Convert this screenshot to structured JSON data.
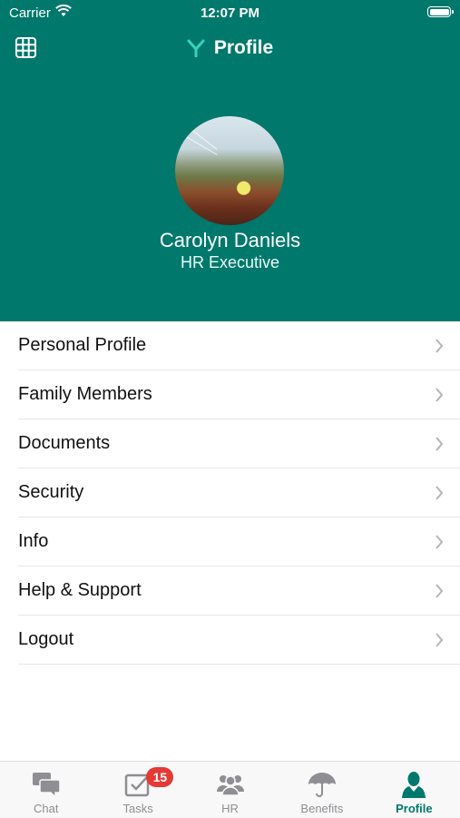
{
  "status_bar": {
    "carrier": "Carrier",
    "time": "12:07 PM"
  },
  "nav": {
    "title": "Profile",
    "logo": "y-logo"
  },
  "profile": {
    "name": "Carolyn Daniels",
    "role": "HR Executive"
  },
  "menu": {
    "items": [
      {
        "label": "Personal Profile"
      },
      {
        "label": "Family Members"
      },
      {
        "label": "Documents"
      },
      {
        "label": "Security"
      },
      {
        "label": "Info"
      },
      {
        "label": "Help & Support"
      },
      {
        "label": "Logout"
      }
    ]
  },
  "tabs": {
    "items": [
      {
        "label": "Chat",
        "icon": "chat-icon"
      },
      {
        "label": "Tasks",
        "icon": "tasks-icon",
        "badge": "15"
      },
      {
        "label": "HR",
        "icon": "hr-icon"
      },
      {
        "label": "Benefits",
        "icon": "umbrella-icon"
      },
      {
        "label": "Profile",
        "icon": "person-icon",
        "active": true
      }
    ]
  },
  "colors": {
    "header": "#00786c",
    "accent": "#00786c",
    "badge": "#e53935",
    "logo": "#35d4c0"
  }
}
